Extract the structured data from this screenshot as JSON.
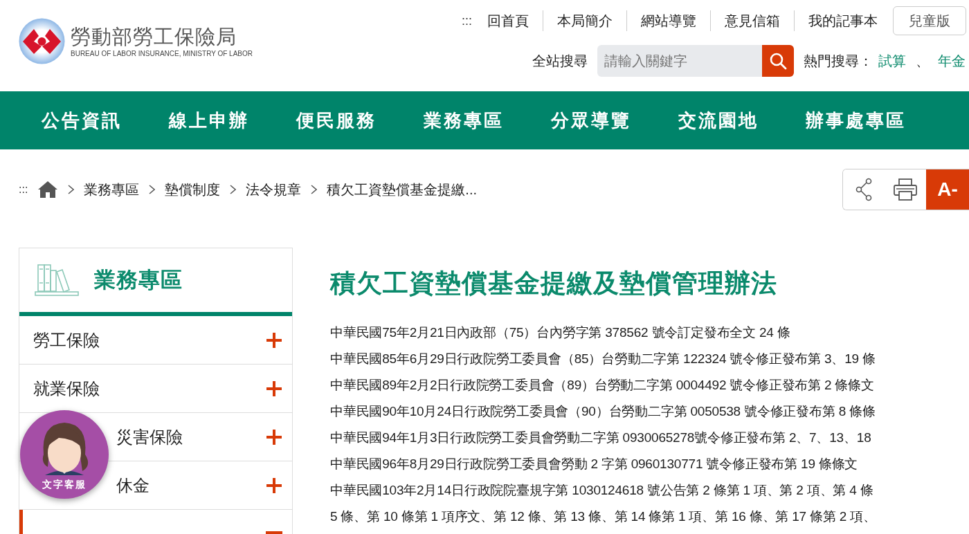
{
  "logo": {
    "title": "勞動部勞工保險局",
    "subtitle": "BUREAU OF LABOR INSURANCE, MINISTRY OF LABOR"
  },
  "top_links": {
    "menu_mark": ":::",
    "items": [
      "回首頁",
      "本局簡介",
      "網站導覽",
      "意見信箱",
      "我的記事本"
    ],
    "kids_button": "兒童版"
  },
  "search": {
    "label": "全站搜尋",
    "placeholder": "請輸入關鍵字",
    "hot_label": "熱門搜尋：",
    "hot_terms": [
      "試算",
      "年金"
    ],
    "separator": "、"
  },
  "main_nav": [
    "公告資訊",
    "線上申辦",
    "便民服務",
    "業務專區",
    "分眾導覽",
    "交流園地",
    "辦事處專區"
  ],
  "breadcrumb": {
    "menu_mark": ":::",
    "items": [
      "業務專區",
      "墊償制度",
      "法令規章",
      "積欠工資墊償基金提繳..."
    ]
  },
  "tools": {
    "font_button": "A-"
  },
  "sidebar": {
    "title": "業務專區",
    "items": [
      {
        "label": "勞工保險",
        "expanded": false,
        "selected": false
      },
      {
        "label": "就業保險",
        "expanded": false,
        "selected": false
      },
      {
        "label": "災害保險",
        "expanded": false,
        "selected": false
      },
      {
        "label": "休金",
        "expanded": false,
        "selected": false
      },
      {
        "expanded": true,
        "selected": true
      }
    ]
  },
  "article": {
    "title": "積欠工資墊償基金提繳及墊償管理辦法",
    "lines": [
      "中華民國75年2月21日內政部（75）台內勞字第 378562 號令訂定發布全文 24 條",
      "中華民國85年6月29日行政院勞工委員會（85）台勞動二字第 122324 號令修正發布第 3、19 條",
      "中華民國89年2月2日行政院勞工委員會（89）台勞動二字第 0004492 號令修正發布第 2 條條文",
      "中華民國90年10月24日行政院勞工委員會（90）台勞動二字第 0050538 號令修正發布第 8 條條",
      "中華民國94年1月3日行政院勞工委員會勞動二字第 0930065278號令修正發布第 2、7、13、18",
      "中華民國96年8月29日行政院勞工委員會勞動 2 字第 0960130771 號令修正發布第 19 條條文",
      "中華民國103年2月14日行政院院臺規字第 1030124618 號公告第 2 條第 1 項、第 2 項、第 4 條",
      "5 條、第 10 條第 1 項序文、第 12 條、第 13 條、第 14 條第 1 項、第 16 條、第 17 條第 2 項、"
    ]
  },
  "chat": {
    "label": "文字客服"
  }
}
